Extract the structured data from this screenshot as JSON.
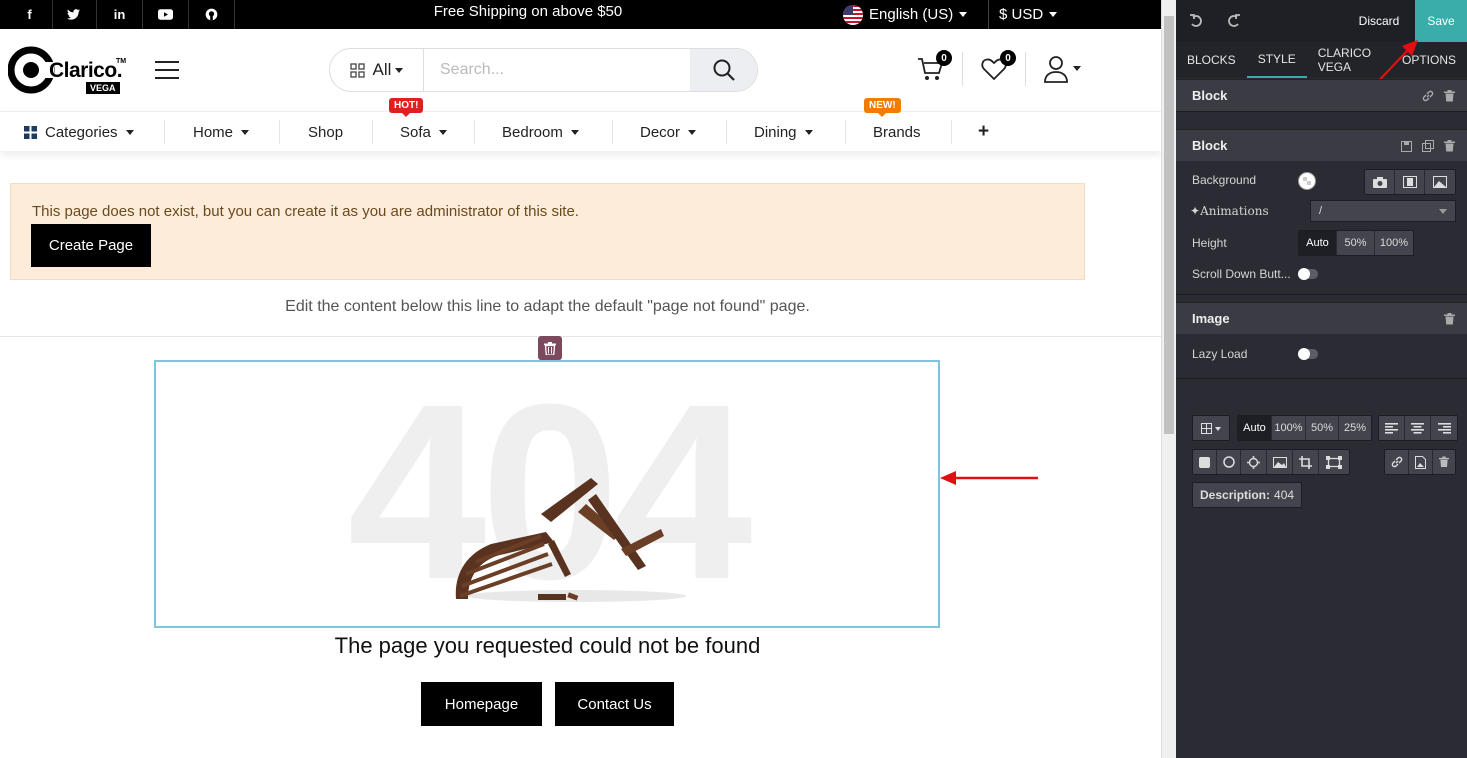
{
  "topbar": {
    "shipping_text": "Free Shipping on above $50",
    "language": "English (US)",
    "currency": "$ USD",
    "social": [
      "facebook-icon",
      "twitter-icon",
      "linkedin-icon",
      "youtube-icon",
      "github-icon"
    ]
  },
  "header": {
    "logo_text": "Clarico.",
    "logo_tm": "TM",
    "logo_sub": "VEGA",
    "search_category": "All",
    "search_placeholder": "Search...",
    "cart_count": "0",
    "wishlist_count": "0"
  },
  "nav": {
    "categories": "Categories",
    "home": "Home",
    "shop": "Shop",
    "sofa": "Sofa",
    "sofa_tag": "HOT!",
    "bedroom": "Bedroom",
    "decor": "Decor",
    "dining": "Dining",
    "brands": "Brands",
    "brands_tag": "NEW!",
    "add": "+"
  },
  "alert": {
    "message": "This page does not exist, but you can create it as you are administrator of this site.",
    "button": "Create Page"
  },
  "content": {
    "edit_note": "Edit the content below this line to adapt the default \"page not found\" page.",
    "big_text": "404",
    "heading": "The page you requested could not be found",
    "homepage_button": "Homepage",
    "contact_button": "Contact Us"
  },
  "panel": {
    "discard": "Discard",
    "save": "Save",
    "tabs": [
      "BLOCKS",
      "STYLE",
      "CLARICO VEGA",
      "OPTIONS"
    ],
    "section1_title": "Block",
    "section2_title": "Block",
    "background_label": "Background",
    "animations_label": "Animations",
    "animations_value": "/",
    "height_label": "Height",
    "height_options": [
      "Auto",
      "50%",
      "100%"
    ],
    "scroll_label": "Scroll Down Butt...",
    "image_title": "Image",
    "lazy_label": "Lazy Load",
    "width_options": [
      "Auto",
      "100%",
      "50%",
      "25%"
    ],
    "description_label": "Description:",
    "description_value": "404"
  },
  "colors": {
    "accent": "#3aadaa",
    "alert_bg": "#fcecd9",
    "hot_tag": "#e02020",
    "new_tag": "#f07c00",
    "annotation_arrow": "#e01010"
  }
}
